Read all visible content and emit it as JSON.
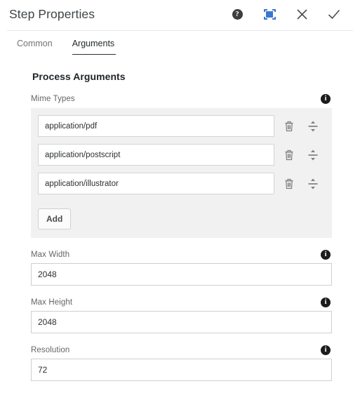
{
  "header": {
    "title": "Step Properties",
    "actions": [
      {
        "name": "help-icon",
        "label": "?",
        "title": "Help"
      },
      {
        "name": "maximize-icon",
        "label": "",
        "title": "Maximize"
      },
      {
        "name": "close-icon",
        "label": "",
        "title": "Close"
      },
      {
        "name": "confirm-icon",
        "label": "",
        "title": "Done"
      }
    ]
  },
  "tabs": [
    {
      "label": "Common",
      "active": false
    },
    {
      "label": "Arguments",
      "active": true
    }
  ],
  "main": {
    "section_title": "Process Arguments",
    "mime_types": {
      "label": "Mime Types",
      "info_label": "i",
      "items": [
        {
          "value": "application/pdf"
        },
        {
          "value": "application/postscript"
        },
        {
          "value": "application/illustrator"
        }
      ],
      "add_label": "Add",
      "row_actions": [
        {
          "name": "delete-icon",
          "title": "Delete"
        },
        {
          "name": "reorder-icon",
          "title": "Reorder"
        }
      ]
    },
    "fields": [
      {
        "label": "Max Width",
        "value": "2048",
        "info_label": "i"
      },
      {
        "label": "Max Height",
        "value": "2048",
        "info_label": "i"
      },
      {
        "label": "Resolution",
        "value": "72",
        "info_label": "i"
      }
    ]
  },
  "colors": {
    "accent_blue": "#3a76d2",
    "panel_bg": "#ffffff",
    "list_bg": "#f1f1f1",
    "text_dark": "#23282c",
    "text_muted": "#6e7276"
  }
}
